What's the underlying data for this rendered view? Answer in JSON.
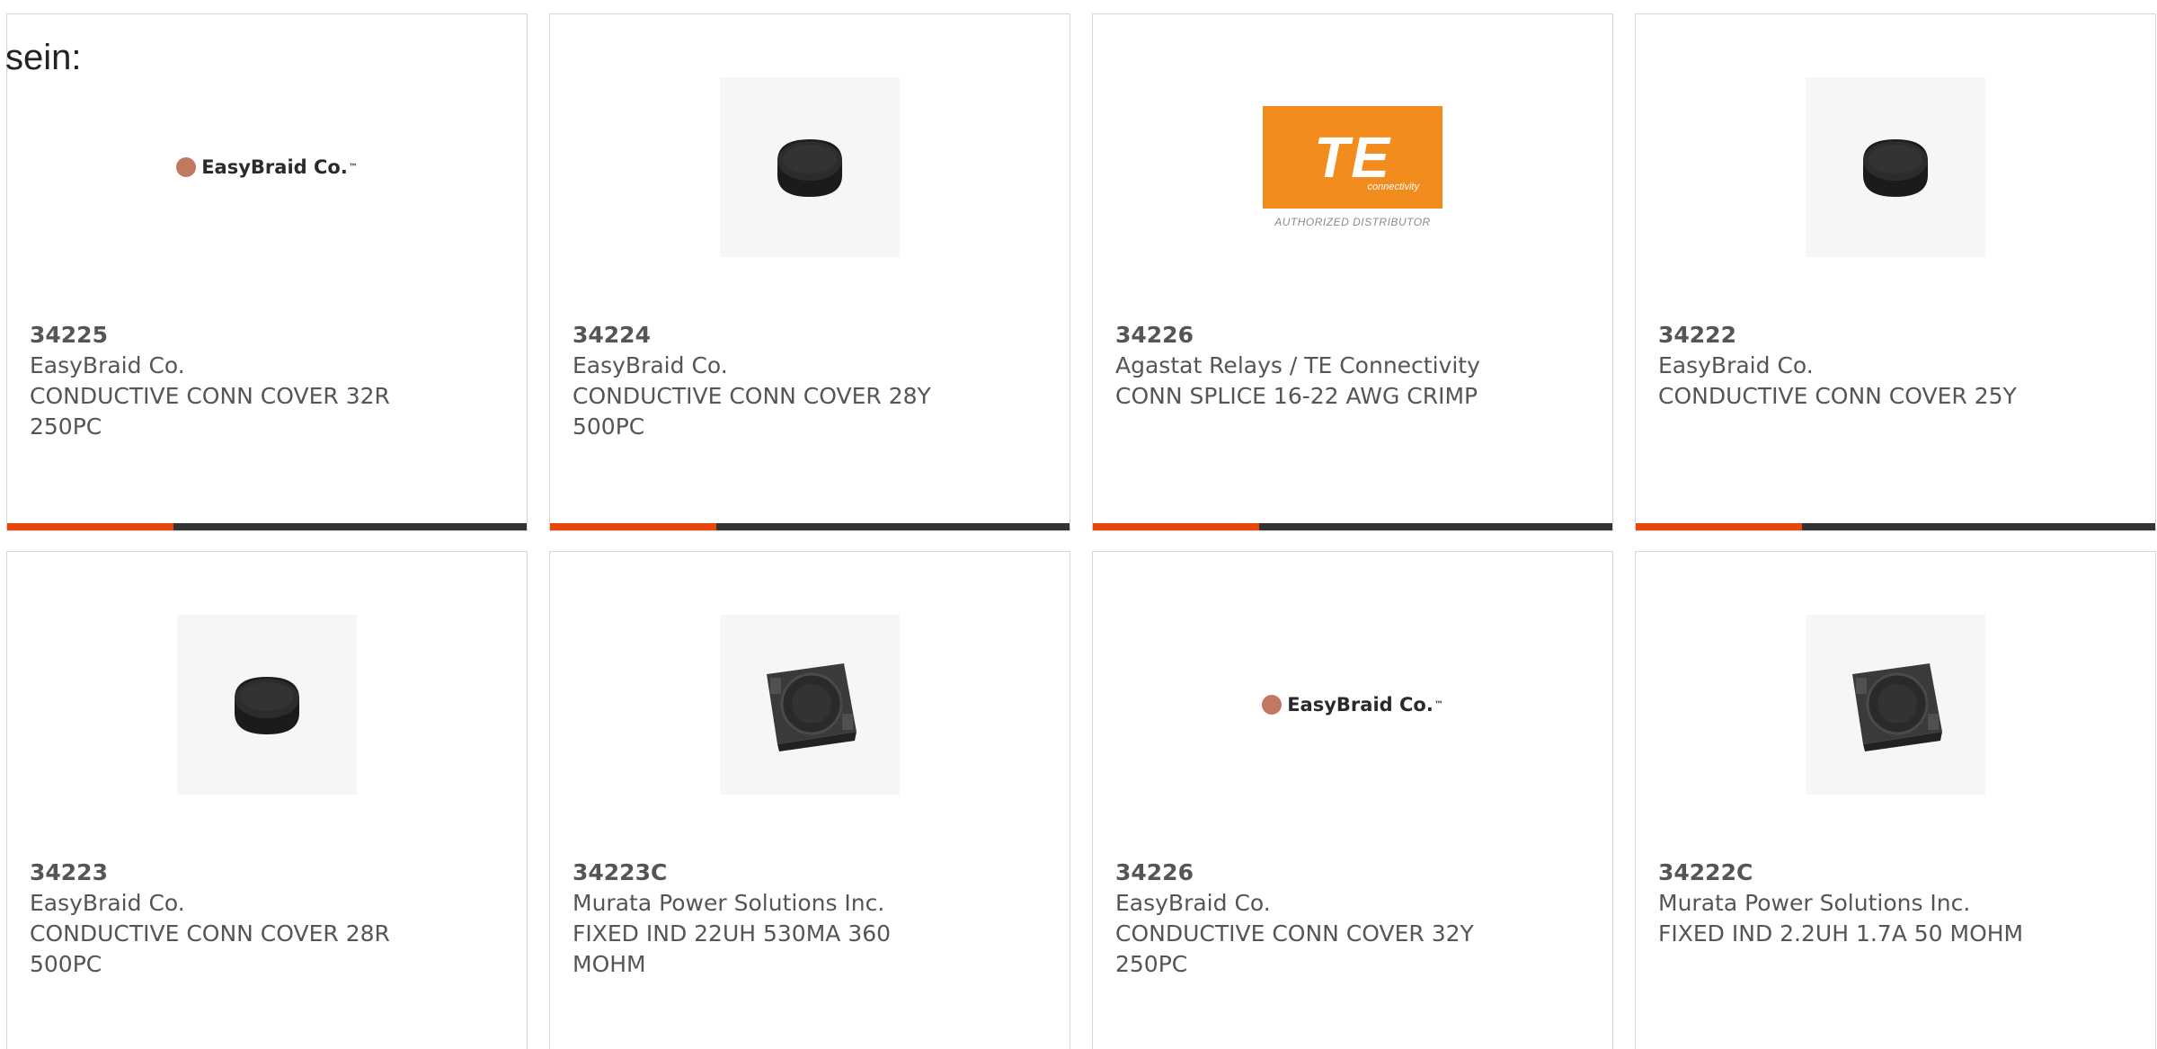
{
  "lead_text": "sein:",
  "colors": {
    "accent": "#e8460a",
    "track": "#333333",
    "text": "#555555",
    "border": "#d6d6d6",
    "te_orange": "#f28c1c"
  },
  "brand_logos": {
    "easybraid": "EasyBraid Co.",
    "easybraid_tm": "™",
    "te": "TE",
    "te_sub": "connectivity",
    "te_caption": "AUTHORIZED DISTRIBUTOR"
  },
  "cards": [
    {
      "image": "easybraid-logo",
      "part_number": "34225",
      "manufacturer": "EasyBraid Co.",
      "description_line1": "CONDUCTIVE CONN COVER 32R",
      "description_line2": "250PC",
      "progress": 0.32
    },
    {
      "image": "black-cap-icon",
      "part_number": "34224",
      "manufacturer": "EasyBraid Co.",
      "description_line1": "CONDUCTIVE CONN COVER 28Y",
      "description_line2": "500PC",
      "progress": 0.32
    },
    {
      "image": "te-connectivity-logo",
      "part_number": "34226",
      "manufacturer": "Agastat Relays / TE Connectivity",
      "description_line1": "CONN SPLICE 16-22 AWG CRIMP",
      "description_line2": "",
      "progress": 0.32
    },
    {
      "image": "black-cap-icon",
      "part_number": "34222",
      "manufacturer": "EasyBraid Co.",
      "description_line1": "CONDUCTIVE CONN COVER 25Y",
      "description_line2": "",
      "progress": 0.32
    },
    {
      "image": "black-cap-icon",
      "part_number": "34223",
      "manufacturer": "EasyBraid Co.",
      "description_line1": "CONDUCTIVE CONN COVER 28R",
      "description_line2": "500PC"
    },
    {
      "image": "inductor-icon",
      "part_number": "34223C",
      "manufacturer": "Murata Power Solutions Inc.",
      "description_line1": "FIXED IND 22UH 530MA 360",
      "description_line2": "MOHM"
    },
    {
      "image": "easybraid-logo",
      "part_number": "34226",
      "manufacturer": "EasyBraid Co.",
      "description_line1": "CONDUCTIVE CONN COVER 32Y",
      "description_line2": "250PC"
    },
    {
      "image": "inductor-icon",
      "part_number": "34222C",
      "manufacturer": "Murata Power Solutions Inc.",
      "description_line1": "FIXED IND 2.2UH 1.7A 50 MOHM",
      "description_line2": ""
    }
  ]
}
